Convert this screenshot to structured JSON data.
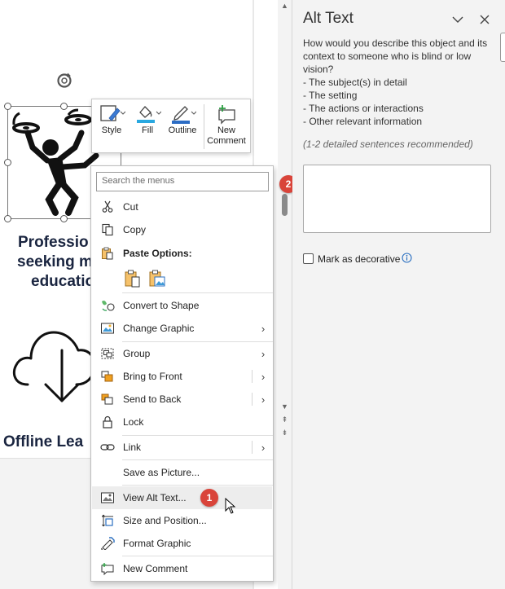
{
  "document": {
    "heading_lines": [
      "Professio",
      "seeking m",
      "educatio"
    ],
    "offline_label": "Offline Lea"
  },
  "mini_toolbar": {
    "style_label": "Style",
    "fill_label": "Fill",
    "outline_label": "Outline",
    "new_comment_label_1": "New",
    "new_comment_label_2": "Comment",
    "fill_color": "#29a8e0",
    "outline_color": "#2b6cc4"
  },
  "context_menu": {
    "search_placeholder": "Search the menus",
    "items": {
      "cut": "Cut",
      "copy": "Copy",
      "paste_options": "Paste Options:",
      "convert_to_shape": "Convert to Shape",
      "change_graphic": "Change Graphic",
      "group": "Group",
      "bring_to_front": "Bring to Front",
      "send_to_back": "Send to Back",
      "lock": "Lock",
      "link": "Link",
      "save_as_picture": "Save as Picture...",
      "view_alt_text": "View Alt Text...",
      "size_and_position": "Size and Position...",
      "format_graphic": "Format Graphic",
      "new_comment": "New Comment"
    }
  },
  "callouts": {
    "step1": "1",
    "step2": "2",
    "color": "#d9443a"
  },
  "alt_text_pane": {
    "title": "Alt Text",
    "description": "How would you describe this object and its context to someone who is blind or low vision?",
    "bullets": [
      "- The subject(s) in detail",
      "- The setting",
      "- The actions or interactions",
      "- Other relevant information"
    ],
    "hint": "(1-2 detailed sentences recommended)",
    "textarea_value": "",
    "mark_decorative_label": "Mark as decorative",
    "mark_decorative_checked": false
  },
  "icons": {
    "collapse": "chevron-down-icon",
    "close": "close-icon",
    "info": "info-icon"
  }
}
